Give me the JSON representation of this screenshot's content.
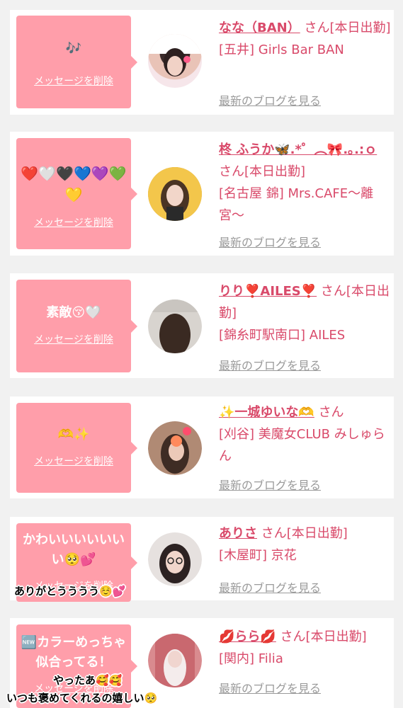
{
  "colors": {
    "bubble": "#ff9eaa",
    "accent": "#d94a6a",
    "muted": "#9a9a9a",
    "background": "#f1f1f1"
  },
  "cards": [
    {
      "message": "🎶",
      "delete_label": "メッセージを削除",
      "name": "なな（BAN）",
      "suffix": "さん[本日出勤]",
      "shop": "[五井] Girls Bar BAN",
      "blog_label": "最新のブログを見る"
    },
    {
      "message": "❤️🤍🖤💙💜💚💛",
      "delete_label": "メッセージを削除",
      "name": "柊 ふうか🦋.*゜︵🎀.｡.:ｏ",
      "suffix": "さん[本日出勤]",
      "shop": "[名古屋 錦] Mrs.CAFE〜離宮〜",
      "blog_label": "最新のブログを見る"
    },
    {
      "message": "素敵😚🤍",
      "delete_label": "メッセージを削除",
      "name": "りり❣️AILES❣️",
      "suffix": "さん[本日出勤]",
      "shop": "[錦糸町駅南口] AILES",
      "blog_label": "最新のブログを見る"
    },
    {
      "message": "🫶✨",
      "delete_label": "メッセージを削除",
      "name": "✨一城ゆいな🫶",
      "suffix": "さん",
      "shop": "[刈谷] 美魔女CLUB みしゅらん",
      "blog_label": "最新のブログを見る"
    },
    {
      "message": "かわいいいいいいい🥺💕",
      "delete_label": "メッセージを削除",
      "name": "ありさ",
      "suffix": "さん[本日出勤]",
      "shop": "[木屋町] 京花",
      "blog_label": "最新のブログを見る"
    },
    {
      "message": "🆕カラーめっちゃ似合ってる！",
      "delete_label": "メッセージを削除",
      "name": "💋らら💋",
      "suffix": "さん[本日出勤]",
      "shop": "[関内] Filia",
      "blog_label": "最新のブログを見る"
    }
  ],
  "overlays": {
    "reply_1": "ありがとうううう☺️💕",
    "reply_2": "やったあ🥰🥰",
    "reply_3": "いつも褒めてくれるの嬉しい🥺"
  }
}
